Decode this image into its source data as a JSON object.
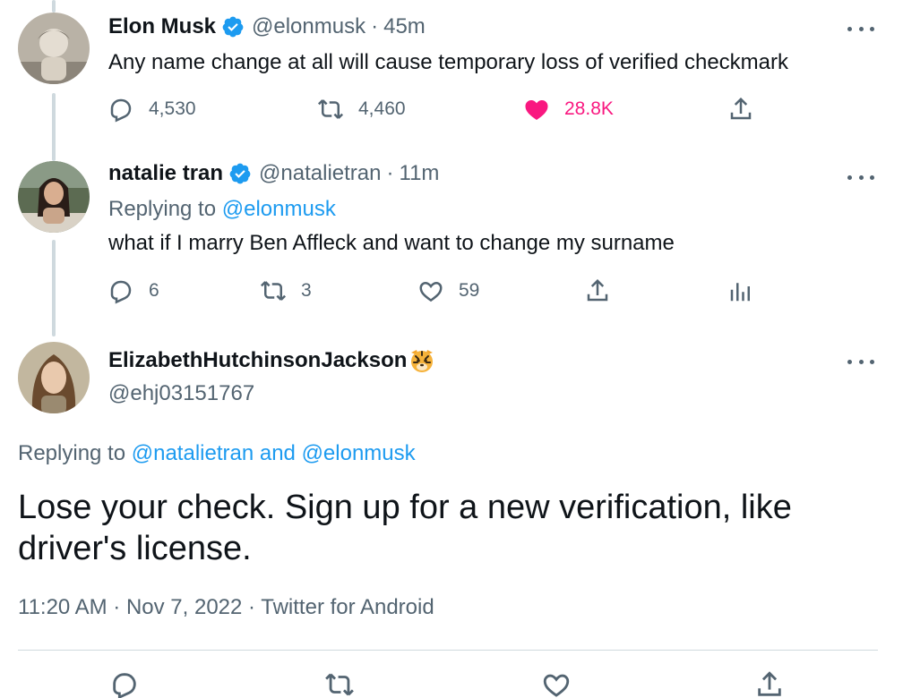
{
  "tweets": [
    {
      "display_name": "Elon Musk",
      "handle": "@elonmusk",
      "time": "45m",
      "text": "Any name change at all will cause temporary loss of verified checkmark",
      "replies": "4,530",
      "retweets": "4,460",
      "likes": "28.8K"
    },
    {
      "display_name": "natalie tran",
      "handle": "@natalietran",
      "time": "11m",
      "replying_label": "Replying to",
      "replying_to": "@elonmusk",
      "text": "what if I marry Ben Affleck and want to change my surname",
      "replies": "6",
      "retweets": "3",
      "likes": "59"
    }
  ],
  "focused": {
    "display_name": "ElizabethHutchinsonJackson",
    "handle": "@ehj03151767",
    "replying_label": "Replying to",
    "replying_to": "@natalietran and @elonmusk",
    "text": "Lose your check. Sign up for a new verification,  like driver's license.",
    "timestamp": "11:20 AM · Nov 7, 2022 · Twitter for Android"
  },
  "colors": {
    "accent": "#1d9bf0",
    "like": "#f91880",
    "secondary_text": "#536471"
  },
  "icons": [
    "verified-badge-icon",
    "more-icon",
    "reply-icon",
    "retweet-icon",
    "like-icon",
    "share-icon",
    "analytics-icon",
    "tiger-emoji-icon"
  ]
}
